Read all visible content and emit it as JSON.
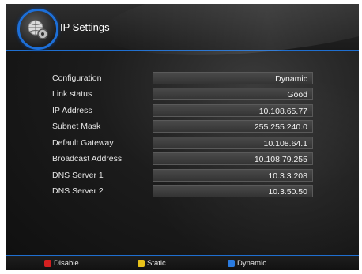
{
  "header": {
    "title": "IP Settings",
    "icon": "network-settings-icon"
  },
  "settings": [
    {
      "label": "Configuration",
      "value": "Dynamic"
    },
    {
      "label": "Link status",
      "value": "Good"
    },
    {
      "label": "IP Address",
      "value": "10.108.65.77"
    },
    {
      "label": "Subnet Mask",
      "value": "255.255.240.0"
    },
    {
      "label": "Default Gateway",
      "value": "10.108.64.1"
    },
    {
      "label": "Broadcast Address",
      "value": "10.108.79.255"
    },
    {
      "label": "DNS Server 1",
      "value": "10.3.3.208"
    },
    {
      "label": "DNS Server 2",
      "value": "10.3.50.50"
    }
  ],
  "footer": {
    "disable": {
      "label": "Disable",
      "color": "#d42020"
    },
    "static": {
      "label": "Static",
      "color": "#e8c21a"
    },
    "dynamic": {
      "label": "Dynamic",
      "color": "#2a7be0"
    }
  }
}
